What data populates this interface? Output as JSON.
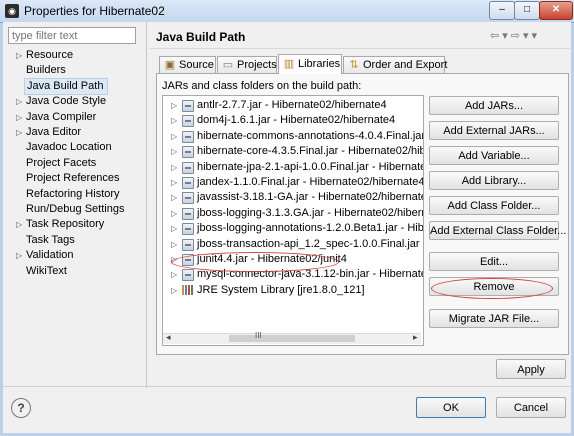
{
  "window": {
    "title": "Properties for Hibernate02",
    "icon": "eclipse-icon",
    "controls": {
      "minimize": "–",
      "maximize": "□",
      "close": "✕"
    }
  },
  "filter": {
    "placeholder": "type filter text"
  },
  "nav_tree": [
    {
      "label": "Resource",
      "expandable": true
    },
    {
      "label": "Builders",
      "expandable": false
    },
    {
      "label": "Java Build Path",
      "expandable": false,
      "selected": true
    },
    {
      "label": "Java Code Style",
      "expandable": true
    },
    {
      "label": "Java Compiler",
      "expandable": true
    },
    {
      "label": "Java Editor",
      "expandable": true
    },
    {
      "label": "Javadoc Location",
      "expandable": false
    },
    {
      "label": "Project Facets",
      "expandable": false
    },
    {
      "label": "Project References",
      "expandable": false
    },
    {
      "label": "Refactoring History",
      "expandable": false
    },
    {
      "label": "Run/Debug Settings",
      "expandable": false
    },
    {
      "label": "Task Repository",
      "expandable": true
    },
    {
      "label": "Task Tags",
      "expandable": false
    },
    {
      "label": "Validation",
      "expandable": true
    },
    {
      "label": "WikiText",
      "expandable": false
    }
  ],
  "page": {
    "title": "Java Build Path",
    "nav": {
      "back": "⇦",
      "back_menu": "▾",
      "forward": "⇨",
      "forward_menu": "▾",
      "view_menu": "▾"
    }
  },
  "tabs": [
    {
      "label": "Source",
      "icon": "source-folder-icon",
      "active": false
    },
    {
      "label": "Projects",
      "icon": "projects-icon",
      "active": false
    },
    {
      "label": "Libraries",
      "icon": "libraries-icon",
      "active": true
    },
    {
      "label": "Order and Export",
      "icon": "order-export-icon",
      "active": false
    }
  ],
  "jars_label": "JARs and class folders on the build path:",
  "libraries": [
    "antlr-2.7.7.jar - Hibernate02/hibernate4",
    "dom4j-1.6.1.jar - Hibernate02/hibernate4",
    "hibernate-commons-annotations-4.0.4.Final.jar - H",
    "hibernate-core-4.3.5.Final.jar - Hibernate02/hibern",
    "hibernate-jpa-2.1-api-1.0.0.Final.jar - Hibernate02/",
    "jandex-1.1.0.Final.jar - Hibernate02/hibernate4",
    "javassist-3.18.1-GA.jar - Hibernate02/hibernate4",
    "jboss-logging-3.1.3.GA.jar - Hibernate02/hibernate",
    "jboss-logging-annotations-1.2.0.Beta1.jar - Hibern",
    "jboss-transaction-api_1.2_spec-1.0.0.Final.jar - Hib",
    "junit4.4.jar - Hibernate02/junit4",
    "mysql-connector-java-3.1.12-bin.jar - Hibernate02/"
  ],
  "jre_library": "JRE System Library [jre1.8.0_121]",
  "scroll": {
    "left": "◂",
    "right": "▸",
    "grip": "III"
  },
  "buttons": {
    "add_jars": "Add JARs...",
    "add_external_jars": "Add External JARs...",
    "add_variable": "Add Variable...",
    "add_library": "Add Library...",
    "add_class_folder": "Add Class Folder...",
    "add_external_class_folder": "Add External Class Folder...",
    "edit": "Edit...",
    "remove": "Remove",
    "migrate_jar": "Migrate JAR File...",
    "apply": "Apply",
    "ok": "OK",
    "cancel": "Cancel",
    "help": "?"
  },
  "colors": {
    "selection": "#dde8f6",
    "annotation": "#d04040",
    "ok_border": "#3c7fb1"
  }
}
